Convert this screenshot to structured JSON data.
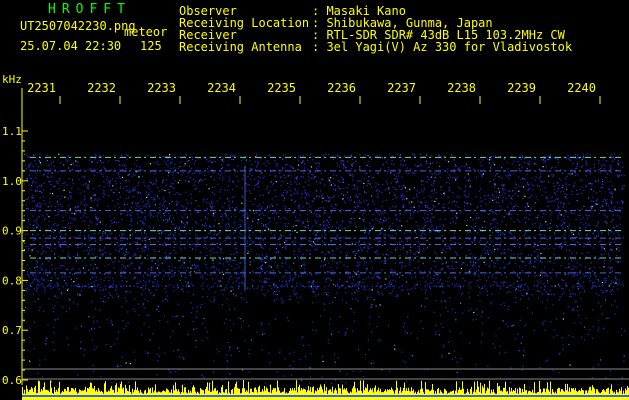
{
  "header": {
    "brand": "HROFFT",
    "filename": "UT2507042230.png",
    "mode": "meteor",
    "datetime": "25.07.04 22:30",
    "count": "125",
    "info": [
      {
        "label": "Observer",
        "value": ": Masaki Kano"
      },
      {
        "label": "Receiving Location",
        "value": ": Shibukawa, Gunma, Japan"
      },
      {
        "label": "Receiver",
        "value": ": RTL-SDR SDR# 43dB L15 103.2MHz CW"
      },
      {
        "label": "Receiving Antenna",
        "value": ": 3el Yagi(V) Az 330 for Vladivostok"
      }
    ]
  },
  "plot": {
    "y_unit": "kHz",
    "y_ticks": [
      "1.1",
      "1.0",
      "0.9",
      "0.8",
      "0.7",
      "0.6"
    ],
    "x_ticks": [
      "2231",
      "2232",
      "2233",
      "2234",
      "2235",
      "2236",
      "2237",
      "2238",
      "2239",
      "2240"
    ],
    "colors": {
      "text": "#ffff00",
      "brand": "#00ff00",
      "noise": "#1a2fd0",
      "signal": "#7dffd0",
      "bottom_bar": "#ffff00"
    }
  }
}
